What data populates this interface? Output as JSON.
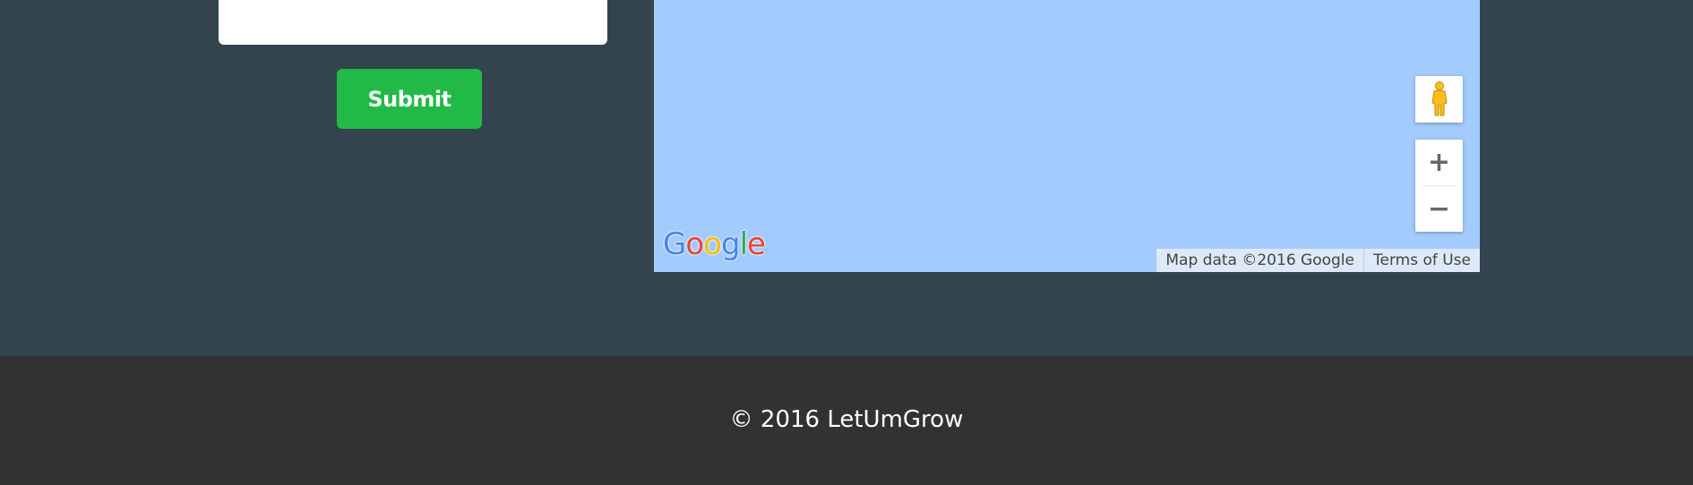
{
  "contact_form": {
    "message_value": "",
    "submit_label": "Submit"
  },
  "map": {
    "logo_letters": [
      "G",
      "o",
      "o",
      "g",
      "l",
      "e"
    ],
    "logo_colors": [
      "#4285f4",
      "#ea4335",
      "#fbbc05",
      "#4285f4",
      "#34a853",
      "#ea4335"
    ],
    "map_data_text": "Map data ©2016 Google",
    "terms_text": "Terms of Use",
    "zoom_in_symbol": "+",
    "zoom_out_symbol": "−",
    "pegman_icon": "pegman-icon",
    "water_color": "#a3cbfd"
  },
  "footer": {
    "copyright": "© 2016 LetUmGrow"
  },
  "colors": {
    "section_bg": "#34444f",
    "footer_bg": "#323232",
    "submit_bg": "#22ba47"
  }
}
